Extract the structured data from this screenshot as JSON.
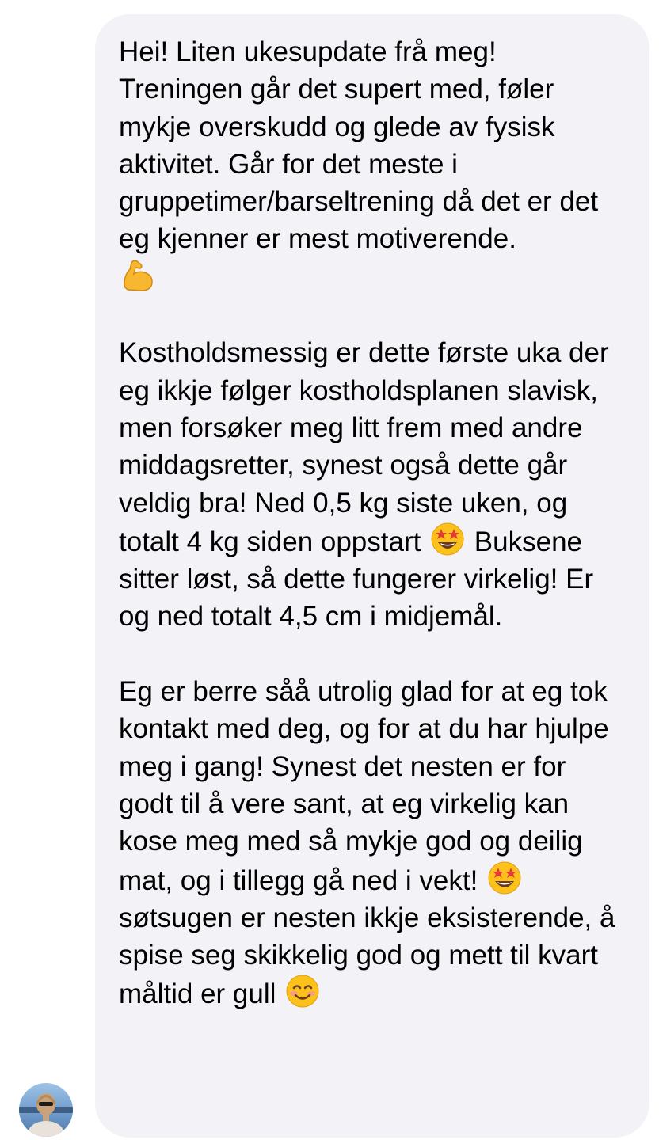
{
  "message": {
    "sender_avatar_icon": "user-avatar-photo",
    "paragraph_1": "Hei! Liten ukesupdate frå meg!\nTreningen går det supert med, føler mykje overskudd og glede av fysisk aktivitet. Går for det meste i gruppetimer/barseltrening då det er det eg kjenner er mest motiverende.\n",
    "paragraph_1_emoji": "flexed-biceps-icon",
    "paragraph_2_a": "Kostholdsmessig er dette første uka der eg ikkje følger kostholdsplanen slavisk, men forsøker meg litt frem med andre middagsretter, synest også dette går veldig bra! Ned 0,5 kg siste uken, og totalt 4 kg siden oppstart ",
    "paragraph_2_emoji": "star-struck-icon",
    "paragraph_2_b": " Buksene sitter løst, så dette fungerer virkelig! Er og ned totalt 4,5 cm i midjemål.",
    "paragraph_3_a": "Eg er berre såå utrolig glad for at eg tok kontakt med deg, og for at du har hjulpe meg i gang! Synest det nesten er for godt til å vere sant, at eg virkelig kan kose meg med så mykje god og deilig mat, og i tillegg gå ned i vekt! ",
    "paragraph_3_emoji": "star-struck-icon",
    "paragraph_3_b": " søtsugen er nesten ikkje eksisterende, å spise seg skikkelig god og mett til kvart måltid er gull ",
    "paragraph_3_end_emoji": "smiling-face-icon"
  },
  "colors": {
    "bubble_background": "#f2f2f7",
    "text": "#000000",
    "page_background": "#ffffff"
  }
}
